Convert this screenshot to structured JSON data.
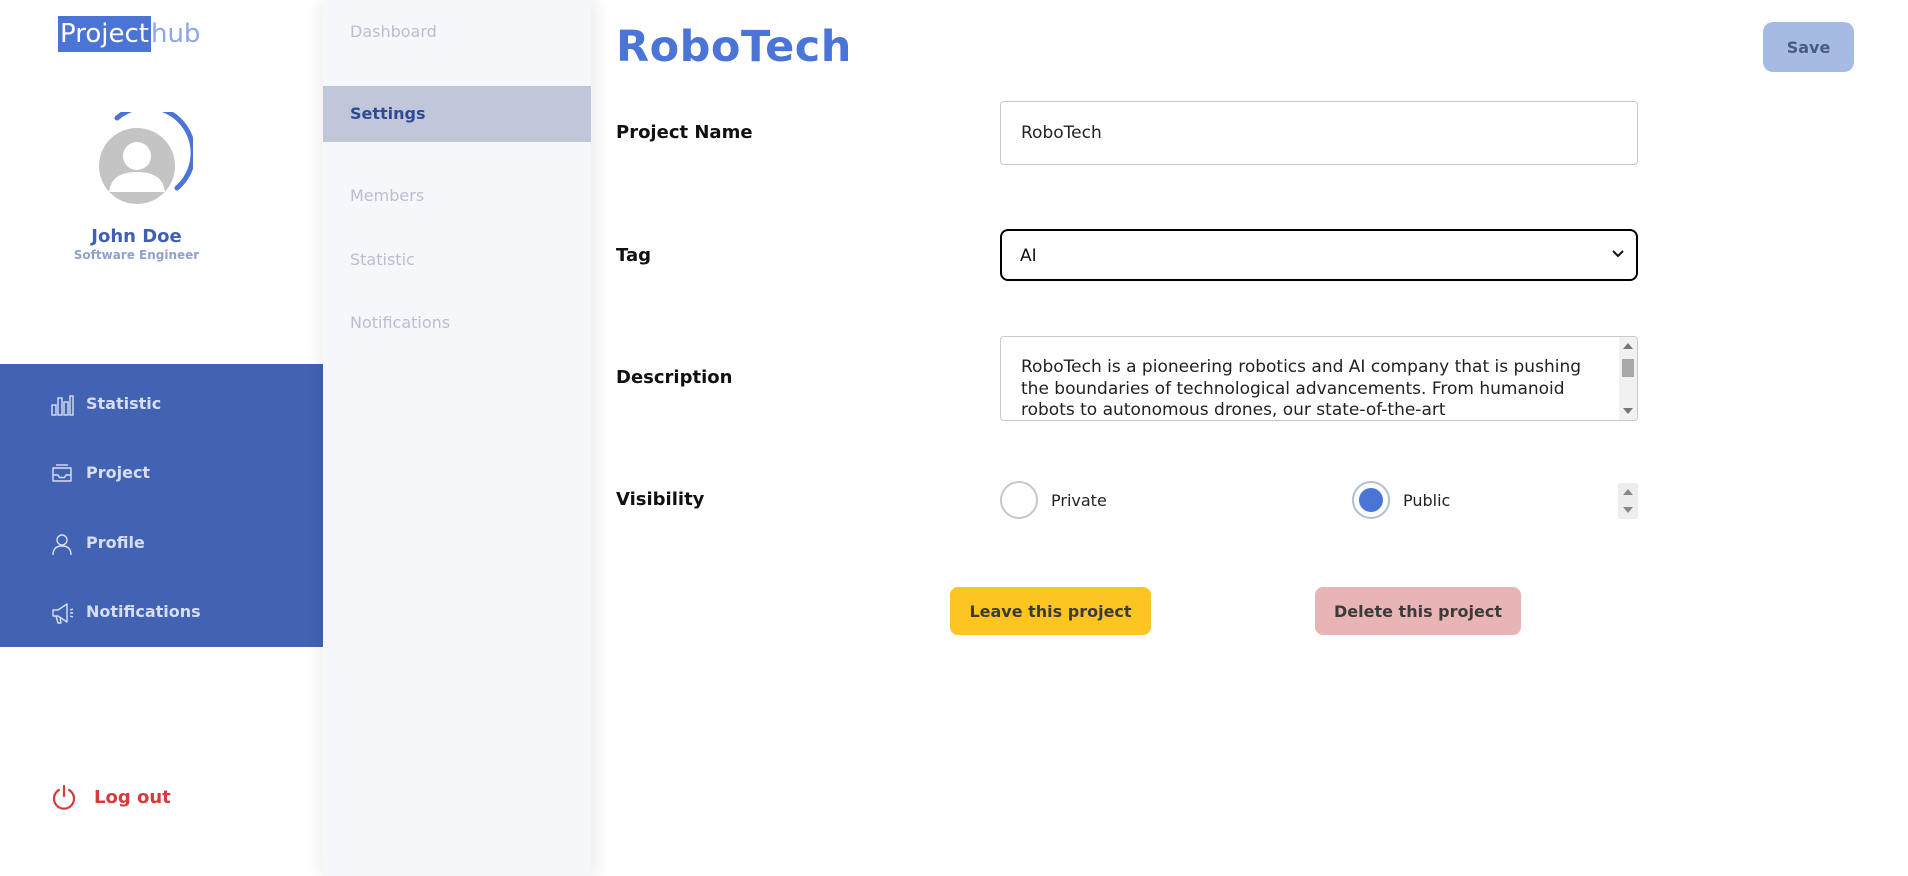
{
  "logo": {
    "highlight": "Project",
    "rest": "hub"
  },
  "user": {
    "name": "John Doe",
    "role": "Software Engineer"
  },
  "nav": {
    "items": [
      {
        "label": "Statistic",
        "icon": "bar-chart-icon"
      },
      {
        "label": "Project",
        "icon": "inbox-icon"
      },
      {
        "label": "Profile",
        "icon": "user-icon"
      },
      {
        "label": "Notifications",
        "icon": "megaphone-icon"
      }
    ],
    "logout": {
      "label": "Log out",
      "icon": "power-icon"
    }
  },
  "submenu": {
    "items": [
      {
        "label": "Dashboard",
        "active": false
      },
      {
        "label": "Settings",
        "active": true
      },
      {
        "label": "Members",
        "active": false
      },
      {
        "label": "Statistic",
        "active": false
      },
      {
        "label": "Notifications",
        "active": false
      }
    ]
  },
  "main": {
    "title": "RoboTech",
    "save_label": "Save",
    "fields": {
      "project_name": {
        "label": "Project Name",
        "value": "RoboTech"
      },
      "tag": {
        "label": "Tag",
        "value": "AI"
      },
      "description": {
        "label": "Description",
        "value": "RoboTech is a pioneering robotics and AI company that is pushing the boundaries of technological advancements. From humanoid robots to autonomous drones, our state-of-the-art"
      },
      "visibility": {
        "label": "Visibility",
        "options": [
          {
            "label": "Private",
            "checked": false
          },
          {
            "label": "Public",
            "checked": true
          }
        ]
      }
    },
    "actions": {
      "leave_label": "Leave this project",
      "delete_label": "Delete this project"
    }
  },
  "colors": {
    "accent": "#4a74d6",
    "nav_bg": "#4263b4",
    "logout": "#d63a3a",
    "leave_button": "#fcc521",
    "delete_button": "#e9b4b6",
    "save_button": "#a6bbe3"
  }
}
